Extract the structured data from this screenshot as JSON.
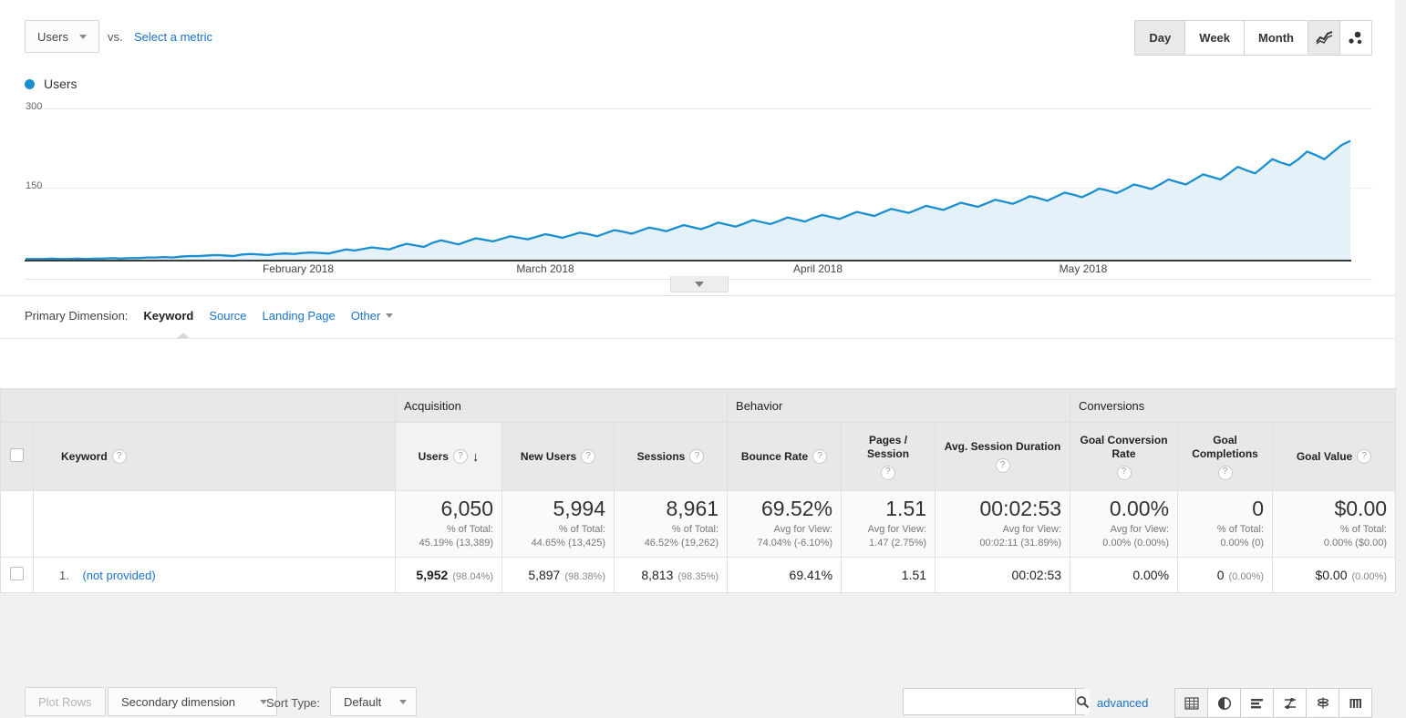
{
  "chart": {
    "metric_button": "Users",
    "vs_label": "vs.",
    "select_metric": "Select a metric",
    "granularity": [
      "Day",
      "Week",
      "Month"
    ],
    "granularity_selected": "Day",
    "chart_type_icons": [
      "line-chart-icon",
      "motion-chart-icon"
    ],
    "legend_label": "Users",
    "line_color": "#1a8fd0",
    "fill_color": "#e5f1f8"
  },
  "chart_data": {
    "type": "area",
    "title": "Users",
    "xlabel": "",
    "ylabel": "Users",
    "ylim": [
      0,
      300
    ],
    "yticks": [
      150,
      300
    ],
    "grid": true,
    "legend_position": "top-left",
    "tick_labels": [
      "February 2018",
      "March 2018",
      "April 2018",
      "May 2018"
    ],
    "series": [
      {
        "name": "Users",
        "values": [
          3,
          3,
          3,
          4,
          3,
          3,
          4,
          3,
          4,
          4,
          5,
          4,
          5,
          5,
          6,
          6,
          7,
          6,
          8,
          9,
          9,
          10,
          11,
          10,
          9,
          12,
          13,
          12,
          11,
          13,
          14,
          13,
          15,
          16,
          15,
          14,
          18,
          22,
          20,
          23,
          26,
          24,
          22,
          28,
          33,
          30,
          27,
          35,
          40,
          36,
          32,
          38,
          44,
          41,
          38,
          43,
          48,
          45,
          42,
          47,
          52,
          49,
          45,
          50,
          55,
          52,
          48,
          54,
          60,
          57,
          53,
          59,
          65,
          62,
          58,
          64,
          70,
          66,
          62,
          68,
          75,
          71,
          67,
          73,
          80,
          76,
          72,
          78,
          85,
          81,
          77,
          84,
          90,
          86,
          82,
          89,
          96,
          92,
          88,
          95,
          102,
          98,
          94,
          101,
          108,
          104,
          100,
          107,
          114,
          110,
          106,
          113,
          120,
          116,
          112,
          119,
          127,
          123,
          118,
          126,
          134,
          130,
          125,
          133,
          142,
          138,
          133,
          141,
          150,
          146,
          141,
          150,
          160,
          155,
          150,
          160,
          170,
          165,
          160,
          172,
          185,
          178,
          172,
          186,
          200,
          193,
          188,
          200,
          215,
          208,
          200,
          214,
          228,
          236
        ]
      }
    ]
  },
  "primary_dimension": {
    "label": "Primary Dimension:",
    "active": "Keyword",
    "links": [
      "Source",
      "Landing Page"
    ],
    "other": "Other"
  },
  "toolbar": {
    "plot_rows": "Plot Rows",
    "secondary_dimension": "Secondary dimension",
    "sort_type_label": "Sort Type:",
    "sort_type_value": "Default",
    "search_value": "",
    "search_placeholder": "",
    "advanced": "advanced",
    "view_icons": [
      "table-view-icon",
      "pie-chart-view-icon",
      "bar-chart-view-icon",
      "comparison-view-icon",
      "performance-view-icon",
      "pivot-view-icon"
    ],
    "view_selected": "table-view-icon"
  },
  "table": {
    "groups": [
      {
        "label": "",
        "span": 2
      },
      {
        "label": "Acquisition",
        "span": 3
      },
      {
        "label": "Behavior",
        "span": 3
      },
      {
        "label": "Conversions",
        "span": 3
      }
    ],
    "dimension_header": "Keyword",
    "columns": [
      {
        "label": "Users",
        "sorted": true,
        "sort_dir": "desc"
      },
      {
        "label": "New Users"
      },
      {
        "label": "Sessions"
      },
      {
        "label": "Bounce Rate"
      },
      {
        "label": "Pages / Session"
      },
      {
        "label": "Avg. Session Duration"
      },
      {
        "label": "Goal Conversion Rate"
      },
      {
        "label": "Goal Completions"
      },
      {
        "label": "Goal Value"
      }
    ],
    "summary": [
      {
        "value": "6,050",
        "line1": "% of Total:",
        "line2": "45.19% (13,389)"
      },
      {
        "value": "5,994",
        "line1": "% of Total:",
        "line2": "44.65% (13,425)"
      },
      {
        "value": "8,961",
        "line1": "% of Total:",
        "line2": "46.52% (19,262)"
      },
      {
        "value": "69.52%",
        "line1": "Avg for View:",
        "line2": "74.04% (-6.10%)"
      },
      {
        "value": "1.51",
        "line1": "Avg for View:",
        "line2": "1.47 (2.75%)"
      },
      {
        "value": "00:02:53",
        "line1": "Avg for View:",
        "line2": "00:02:11 (31.89%)"
      },
      {
        "value": "0.00%",
        "line1": "Avg for View:",
        "line2": "0.00% (0.00%)"
      },
      {
        "value": "0",
        "line1": "% of Total:",
        "line2": "0.00% (0)"
      },
      {
        "value": "$0.00",
        "line1": "% of Total:",
        "line2": "0.00% ($0.00)"
      }
    ],
    "rows": [
      {
        "index": "1.",
        "keyword": "(not provided)",
        "cells": [
          {
            "value": "5,952",
            "pct": "(98.04%)",
            "bold": true
          },
          {
            "value": "5,897",
            "pct": "(98.38%)"
          },
          {
            "value": "8,813",
            "pct": "(98.35%)"
          },
          {
            "value": "69.41%",
            "pct": ""
          },
          {
            "value": "1.51",
            "pct": ""
          },
          {
            "value": "00:02:53",
            "pct": ""
          },
          {
            "value": "0.00%",
            "pct": ""
          },
          {
            "value": "0",
            "pct": "(0.00%)"
          },
          {
            "value": "$0.00",
            "pct": "(0.00%)"
          }
        ]
      }
    ]
  }
}
